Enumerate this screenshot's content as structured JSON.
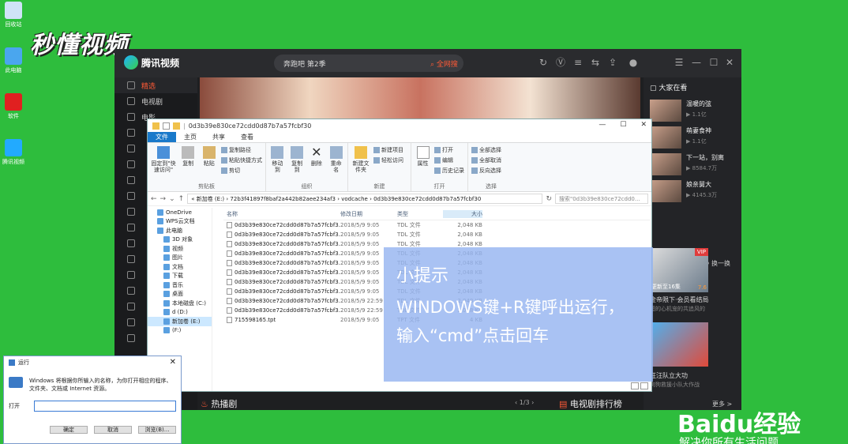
{
  "desktop": {
    "icons": [
      {
        "label": "回收站",
        "color": "#cfe3f7"
      },
      {
        "label": "此电脑",
        "color": "#4aa6ee"
      },
      {
        "label": "软件",
        "color": "#e02020"
      },
      {
        "label": "腾讯视频",
        "color": "#22aaff"
      }
    ],
    "watermark": "秒懂视频",
    "baidu_logo": "Baidu经验",
    "baidu_slogan": "解决你所有生活问题"
  },
  "video_app": {
    "logo_text": "腾讯视频",
    "search_value": "奔跑吧 第2季",
    "search_button": "全网搜",
    "sidebar": [
      {
        "label": "精选",
        "active": true
      },
      {
        "label": "电视剧",
        "active": false
      },
      {
        "label": "电影",
        "active": false
      }
    ],
    "right_panel": {
      "header": "大家在看",
      "items": [
        {
          "title": "温暖的弦",
          "meta": "1.1亿"
        },
        {
          "title": "萌妻食神",
          "meta": "1.1亿"
        },
        {
          "title": "下一站，别离",
          "meta": "8584.7万"
        },
        {
          "title": "娘亲舅大",
          "meta": "4145.3万"
        }
      ],
      "change_label": "换一换",
      "posters": [
        {
          "title": "金帝限下·会员看结局",
          "subtitle": "超的心机宠的共追风的",
          "badge": "VIP",
          "episode": "更新至16集",
          "score": "7.6"
        },
        {
          "title": "汪汪队立大功",
          "subtitle": "狗狗救援小队大作战",
          "badge": "",
          "episode": "",
          "score": ""
        }
      ]
    },
    "bottom_left": "热播剧",
    "bottom_pager": "1/3",
    "bottom_right": "电视剧排行榜",
    "bottom_more": "更多 >"
  },
  "explorer": {
    "title": "0d3b39e830ce72cdd0d87b7a57fcbf30",
    "tabs": [
      "文件",
      "主页",
      "共享",
      "查看"
    ],
    "window_buttons": [
      "—",
      "☐",
      "✕"
    ],
    "ribbon": {
      "clipboard": {
        "label": "剪贴板",
        "pin": "固定到\"快速访问\"",
        "copy": "复制",
        "paste": "粘贴",
        "copy_path": "复制路径",
        "paste_shortcut": "粘贴快捷方式",
        "cut": "剪切"
      },
      "organize": {
        "label": "组织",
        "move_to": "移动到",
        "copy_to": "复制到",
        "delete": "删除",
        "rename": "重命名"
      },
      "new": {
        "label": "新建",
        "new_folder": "新建文件夹",
        "new_item": "新建项目",
        "easy_access": "轻松访问"
      },
      "open": {
        "label": "打开",
        "properties": "属性",
        "open": "打开",
        "edit": "编辑",
        "history": "历史记录"
      },
      "select": {
        "label": "选择",
        "select_all": "全部选择",
        "select_none": "全部取消",
        "invert": "反向选择"
      }
    },
    "address": "« 新加卷 (E:)  ›  72b3f41897f8baf2a442b82aee234af3  ›  vodcache  ›  0d3b39e830ce72cdd0d87b7a57fcbf30",
    "search_placeholder": "搜索\"0d3b39e830ce72cdd0...",
    "nav": [
      {
        "label": "OneDrive",
        "sub": false,
        "active": false
      },
      {
        "label": "WPS云文档",
        "sub": false,
        "active": false
      },
      {
        "label": "此电脑",
        "sub": false,
        "active": false
      },
      {
        "label": "3D 对象",
        "sub": true,
        "active": false
      },
      {
        "label": "视频",
        "sub": true,
        "active": false
      },
      {
        "label": "图片",
        "sub": true,
        "active": false
      },
      {
        "label": "文档",
        "sub": true,
        "active": false
      },
      {
        "label": "下载",
        "sub": true,
        "active": false
      },
      {
        "label": "音乐",
        "sub": true,
        "active": false
      },
      {
        "label": "桌面",
        "sub": true,
        "active": false
      },
      {
        "label": "本地磁盘 (C:)",
        "sub": true,
        "active": false
      },
      {
        "label": "d (D:)",
        "sub": true,
        "active": false
      },
      {
        "label": "新加卷 (E:)",
        "sub": true,
        "active": true
      },
      {
        "label": "(F:)",
        "sub": true,
        "active": false
      }
    ],
    "columns": {
      "name": "名称",
      "date": "修改日期",
      "type": "类型",
      "size": "大小"
    },
    "files": [
      {
        "name": "0d3b39e830ce72cdd0d87b7a57fcbf3...",
        "date": "2018/5/9 9:05",
        "type": "TDL 文件",
        "size": "2,048 KB"
      },
      {
        "name": "0d3b39e830ce72cdd0d87b7a57fcbf3...",
        "date": "2018/5/9 9:05",
        "type": "TDL 文件",
        "size": "2,048 KB"
      },
      {
        "name": "0d3b39e830ce72cdd0d87b7a57fcbf3...",
        "date": "2018/5/9 9:05",
        "type": "TDL 文件",
        "size": "2,048 KB"
      },
      {
        "name": "0d3b39e830ce72cdd0d87b7a57fcbf3...",
        "date": "2018/5/9 9:05",
        "type": "TDL 文件",
        "size": "2,048 KB"
      },
      {
        "name": "0d3b39e830ce72cdd0d87b7a57fcbf3...",
        "date": "2018/5/9 9:05",
        "type": "TDL 文件",
        "size": "2,048 KB"
      },
      {
        "name": "0d3b39e830ce72cdd0d87b7a57fcbf3...",
        "date": "2018/5/9 9:05",
        "type": "TDL 文件",
        "size": "2,048 KB"
      },
      {
        "name": "0d3b39e830ce72cdd0d87b7a57fcbf3...",
        "date": "2018/5/9 9:05",
        "type": "TDL 文件",
        "size": "2,048 KB"
      },
      {
        "name": "0d3b39e830ce72cdd0d87b7a57fcbf3...",
        "date": "2018/5/9 9:05",
        "type": "TDL 文件",
        "size": "2,048 KB"
      },
      {
        "name": "0d3b39e830ce72cdd0d87b7a57fcbf3...",
        "date": "2018/5/9 22:59",
        "type": "TDL 文件",
        "size": "2,048 KB"
      },
      {
        "name": "0d3b39e830ce72cdd0d87b7a57fcbf3...",
        "date": "2018/5/9 22:59",
        "type": "TDL 文件",
        "size": "2,048 KB"
      },
      {
        "name": "715598165.tpt",
        "date": "2018/5/9 9:05",
        "type": "TPT 文件",
        "size": "4 KB"
      }
    ]
  },
  "tip": {
    "heading": "小提示",
    "line1": "WINDOWS键+R键呼出运行，",
    "line2": "输入“cmd”点击回车"
  },
  "run_dialog": {
    "title": "运行",
    "close": "✕",
    "description": "Windows 将根据你所输入的名称，为你打开相应的程序、文件夹、文档或 Internet 资源。",
    "open_label": "打开",
    "open_value": "",
    "buttons": [
      "确定",
      "取消",
      "浏览(B)..."
    ]
  }
}
